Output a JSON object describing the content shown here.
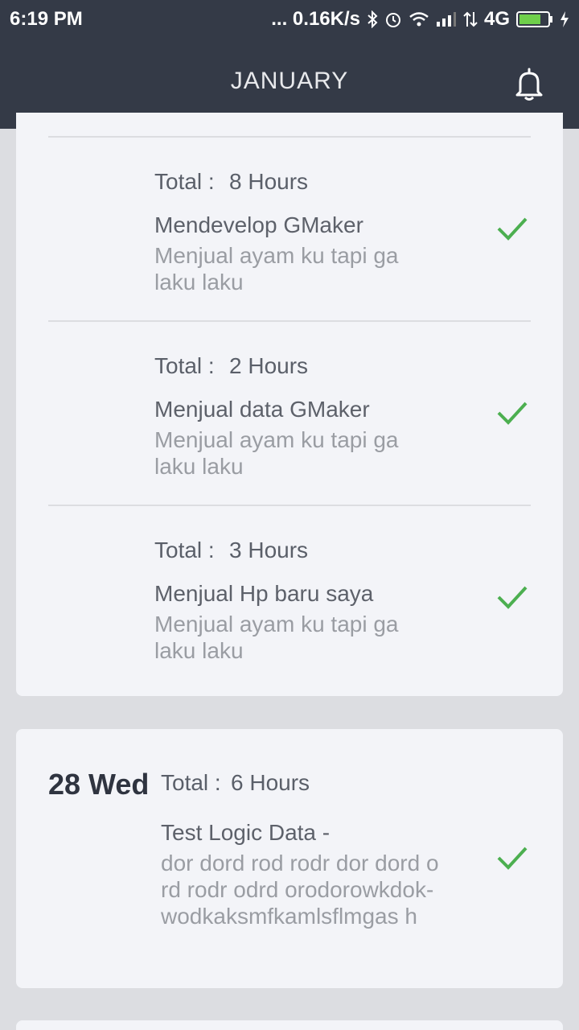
{
  "status_bar": {
    "time": "6:19 PM",
    "network_speed": "... 0.16K/s",
    "network_type": "4G",
    "icons": [
      "bluetooth-icon",
      "alarm-icon",
      "wifi-icon",
      "signal-icon",
      "data-arrows-icon",
      "battery-icon",
      "charging-icon"
    ]
  },
  "header": {
    "title": "JANUARY",
    "icon": "bell-icon"
  },
  "entries": [
    {
      "total_label": "Total :",
      "total_value": "8 Hours",
      "title": "Mendevelop GMaker",
      "description": "Menjual ayam ku tapi ga laku laku",
      "done": true
    },
    {
      "total_label": "Total :",
      "total_value": "2 Hours",
      "title": "Menjual data GMaker",
      "description": "Menjual ayam ku tapi ga laku laku",
      "done": true
    },
    {
      "total_label": "Total :",
      "total_value": "3 Hours",
      "title": "Menjual Hp baru saya",
      "description": "Menjual ayam ku tapi ga laku laku",
      "done": true
    }
  ],
  "day": {
    "date": "28 Wed",
    "total_label": "Total :",
    "total_value": "6 Hours",
    "title": "Test Logic Data -",
    "description": "dor dord rod rodr dor dord ord rodr odrd orodorowkdok-wodkaksmfkamlsflmgas h",
    "done": true
  },
  "colors": {
    "header_bg": "#343a47",
    "page_bg": "#dcdde1",
    "card_bg": "#f3f4f8",
    "check": "#4caf50"
  }
}
